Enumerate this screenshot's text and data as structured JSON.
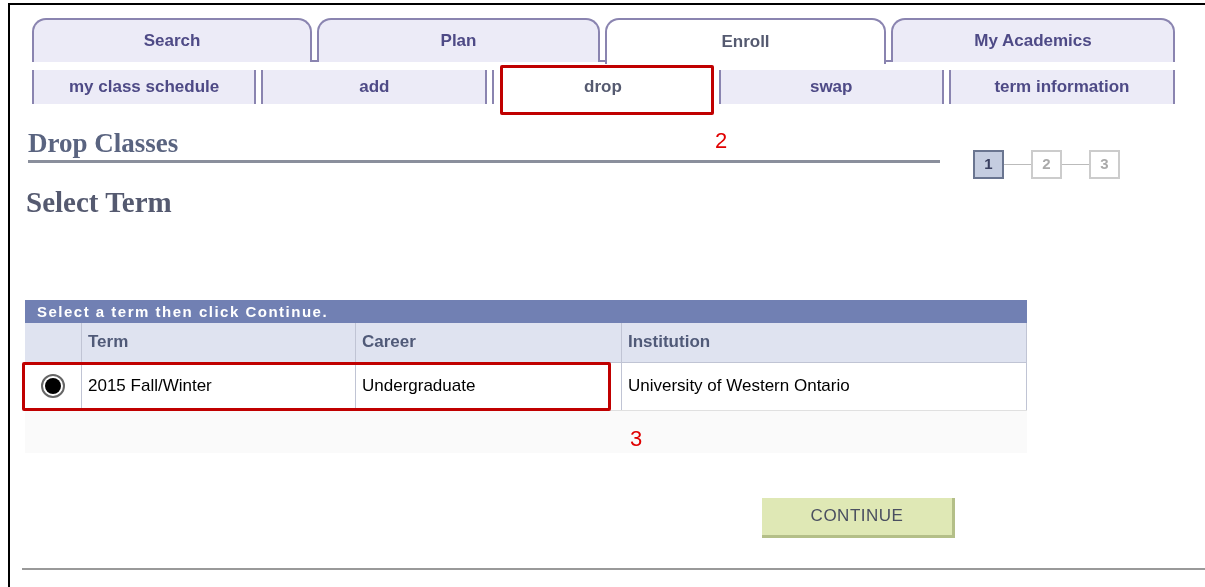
{
  "tabs": [
    {
      "label": "Search",
      "selected": false
    },
    {
      "label": "Plan",
      "selected": false
    },
    {
      "label": "Enroll",
      "selected": true
    },
    {
      "label": "My Academics",
      "selected": false
    }
  ],
  "subtabs": [
    {
      "label": "my class schedule",
      "selected": false
    },
    {
      "label": "add",
      "selected": false
    },
    {
      "label": "drop",
      "selected": true
    },
    {
      "label": "swap",
      "selected": false
    },
    {
      "label": "term information",
      "selected": false
    }
  ],
  "page_title": "Drop Classes",
  "steps": [
    {
      "label": "1",
      "selected": true
    },
    {
      "label": "2",
      "selected": false
    },
    {
      "label": "3",
      "selected": false
    }
  ],
  "section_title": "Select Term",
  "table": {
    "caption": "Select a term then click Continue.",
    "columns": [
      "Term",
      "Career",
      "Institution"
    ],
    "rows": [
      {
        "selected": true,
        "cells": [
          "2015 Fall/Winter",
          "Undergraduate",
          "University of Western Ontario"
        ]
      }
    ]
  },
  "continue_button": "CONTINUE",
  "annotations": [
    {
      "label": "2"
    },
    {
      "label": "3"
    }
  ]
}
